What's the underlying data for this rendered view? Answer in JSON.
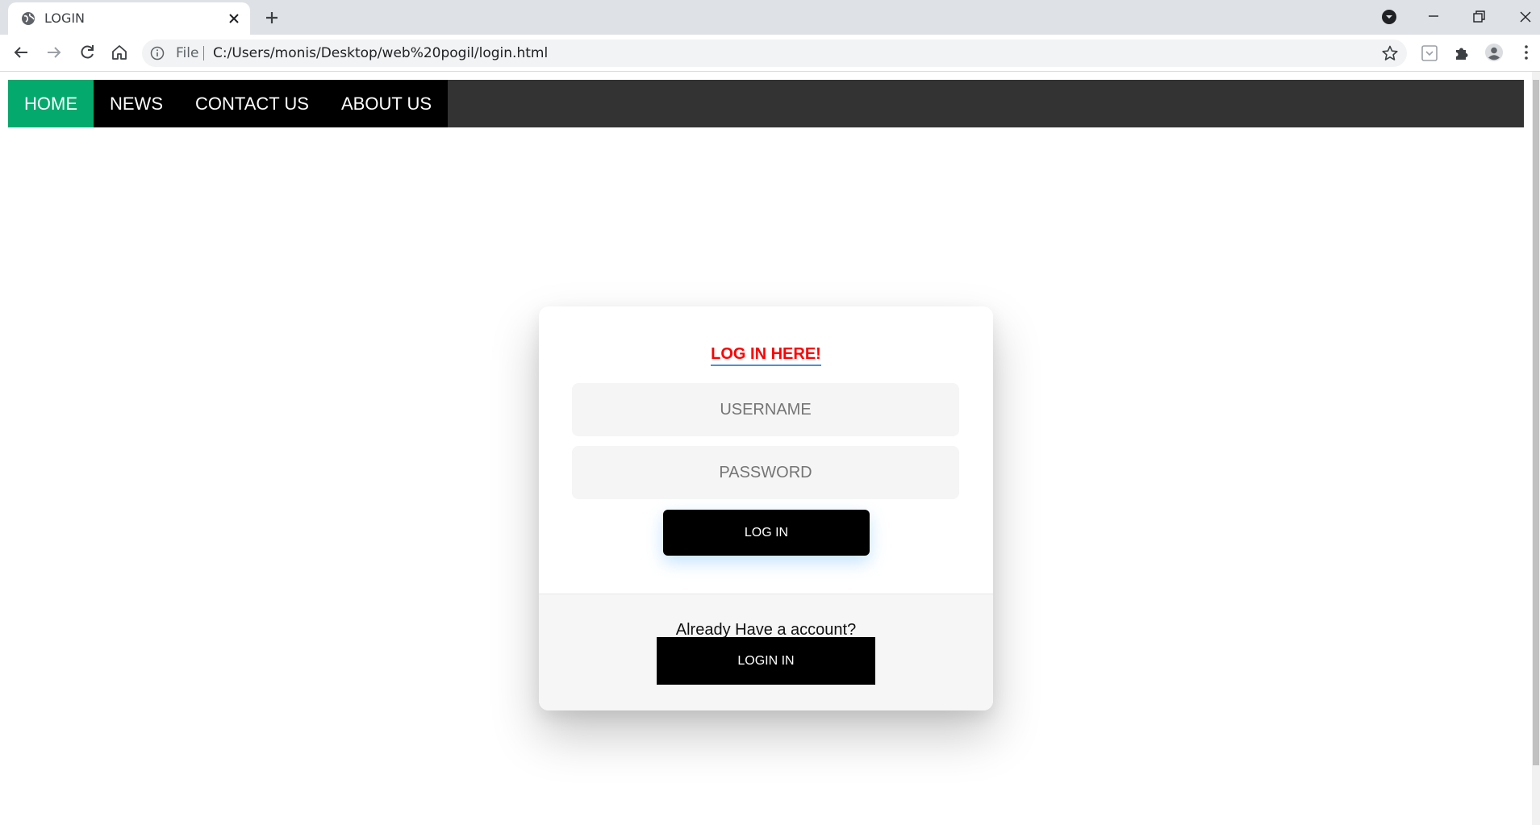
{
  "browser": {
    "tab": {
      "title": "LOGIN"
    },
    "address": {
      "scheme": "File",
      "url": "C:/Users/monis/Desktop/web%20pogil/login.html"
    }
  },
  "icons": {
    "favicon": "globe-icon",
    "tab_close": "close-icon",
    "new_tab": "plus-icon",
    "tab_search": "chevron-down-icon",
    "back": "arrow-left-icon",
    "forward": "arrow-right-icon",
    "reload": "reload-icon",
    "home": "home-icon",
    "site_info": "info-icon",
    "bookmark": "star-icon",
    "pocket": "pocket-icon",
    "extensions": "puzzle-icon",
    "profile": "person-icon",
    "menu": "kebab-menu-icon"
  },
  "nav": {
    "items": [
      {
        "label": "HOME",
        "active": true
      },
      {
        "label": "NEWS",
        "active": false
      },
      {
        "label": "CONTACT US",
        "active": false
      },
      {
        "label": "ABOUT US",
        "active": false
      }
    ]
  },
  "login_card": {
    "title": "LOG IN HERE!",
    "username_placeholder": "USERNAME",
    "password_placeholder": "PASSWORD",
    "login_button": "LOG IN",
    "footer_text": "Already Have a account?",
    "footer_button": "LOGIN IN"
  },
  "colors": {
    "nav_active": "#04aa6d",
    "nav_bar": "#333333",
    "title": "#ff0000"
  }
}
